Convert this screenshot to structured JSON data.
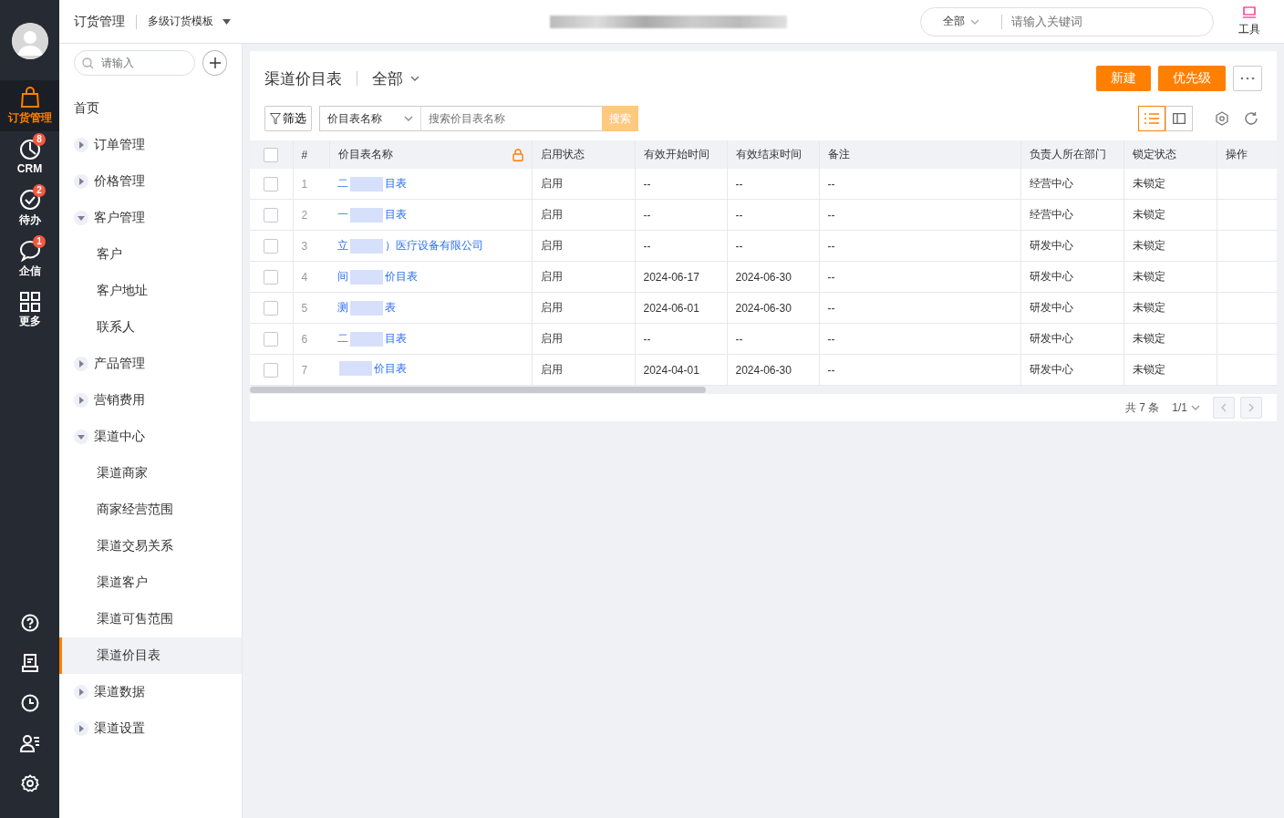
{
  "rail": {
    "items": [
      {
        "kind": "bag",
        "label": "订货管理",
        "selected": true
      },
      {
        "kind": "pie",
        "label": "CRM",
        "badge": "8",
        "selected": false
      },
      {
        "kind": "check",
        "label": "待办",
        "badge": "2",
        "selected": false
      },
      {
        "kind": "chat",
        "label": "企信",
        "badge": "1",
        "selected": false
      },
      {
        "kind": "grid",
        "label": "更多",
        "selected": false
      }
    ],
    "bottom": [
      {
        "kind": "help"
      },
      {
        "kind": "kiosk"
      },
      {
        "kind": "clock"
      },
      {
        "kind": "contacts"
      },
      {
        "kind": "settings"
      }
    ]
  },
  "header": {
    "app": "订货管理",
    "template": "多级订货模板",
    "search_scope": "全部",
    "search_placeholder": "请输入关键词",
    "tool": "工具"
  },
  "sidebar": {
    "search_placeholder": "请输入",
    "items": [
      {
        "label": "首页",
        "selected": false
      },
      {
        "label": "订单管理",
        "expanded": false,
        "selected": false
      },
      {
        "label": "价格管理",
        "expanded": false,
        "selected": false
      },
      {
        "label": "客户管理",
        "expanded": true,
        "selected": false,
        "children": [
          {
            "label": "客户",
            "selected": false
          },
          {
            "label": "客户地址",
            "selected": false
          },
          {
            "label": "联系人",
            "selected": false
          }
        ]
      },
      {
        "label": "产品管理",
        "expanded": false,
        "selected": false
      },
      {
        "label": "营销费用",
        "expanded": false,
        "selected": false
      },
      {
        "label": "渠道中心",
        "expanded": true,
        "selected": false,
        "children": [
          {
            "label": "渠道商家",
            "selected": false
          },
          {
            "label": "商家经营范围",
            "selected": false
          },
          {
            "label": "渠道交易关系",
            "selected": false
          },
          {
            "label": "渠道客户",
            "selected": false
          },
          {
            "label": "渠道可售范围",
            "selected": false
          },
          {
            "label": "渠道价目表",
            "selected": true
          }
        ]
      },
      {
        "label": "渠道数据",
        "expanded": false,
        "selected": false
      },
      {
        "label": "渠道设置",
        "expanded": false,
        "selected": false
      }
    ]
  },
  "page": {
    "title": "渠道价目表",
    "scope": "全部",
    "buttons": [
      "新建",
      "优先级"
    ],
    "filter": "筛选",
    "search_field": "价目表名称",
    "search_placeholder": "搜索价目表名称",
    "search_button": "搜索",
    "views": [
      {
        "kind": "list",
        "selected": true
      },
      {
        "kind": "split",
        "selected": false
      }
    ]
  },
  "table": {
    "header_checked": false,
    "columns": [
      "#",
      "价目表名称",
      "启用状态",
      "有效开始时间",
      "有效结束时间",
      "备注",
      "负责人所在部门",
      "锁定状态",
      "操作"
    ],
    "rows": [
      {
        "checked": false,
        "index": "1",
        "name_start": "二",
        "name_end": "目表",
        "status": "启用",
        "start": "--",
        "end": "--",
        "note": "--",
        "dept": "经营中心",
        "lock": "未锁定"
      },
      {
        "checked": false,
        "index": "2",
        "name_start": "一",
        "name_end": "目表",
        "status": "启用",
        "start": "--",
        "end": "--",
        "note": "--",
        "dept": "经营中心",
        "lock": "未锁定"
      },
      {
        "checked": false,
        "index": "3",
        "name_start": "立",
        "name_end": "）医疗设备有限公司",
        "status": "启用",
        "start": "--",
        "end": "--",
        "note": "--",
        "dept": "研发中心",
        "lock": "未锁定"
      },
      {
        "checked": false,
        "index": "4",
        "name_start": "间",
        "name_end": "价目表",
        "status": "启用",
        "start": "2024-06-17",
        "end": "2024-06-30",
        "note": "--",
        "dept": "研发中心",
        "lock": "未锁定"
      },
      {
        "checked": false,
        "index": "5",
        "name_start": "测",
        "name_end": "表",
        "status": "启用",
        "start": "2024-06-01",
        "end": "2024-06-30",
        "note": "--",
        "dept": "研发中心",
        "lock": "未锁定"
      },
      {
        "checked": false,
        "index": "6",
        "name_start": "二",
        "name_end": "目表",
        "status": "启用",
        "start": "--",
        "end": "--",
        "note": "--",
        "dept": "研发中心",
        "lock": "未锁定"
      },
      {
        "checked": false,
        "index": "7",
        "name_end": "价目表",
        "status": "启用",
        "start": "2024-04-01",
        "end": "2024-06-30",
        "note": "--",
        "dept": "研发中心",
        "lock": "未锁定"
      }
    ]
  },
  "pager": {
    "total": "共 7 条",
    "page": "1/1"
  }
}
